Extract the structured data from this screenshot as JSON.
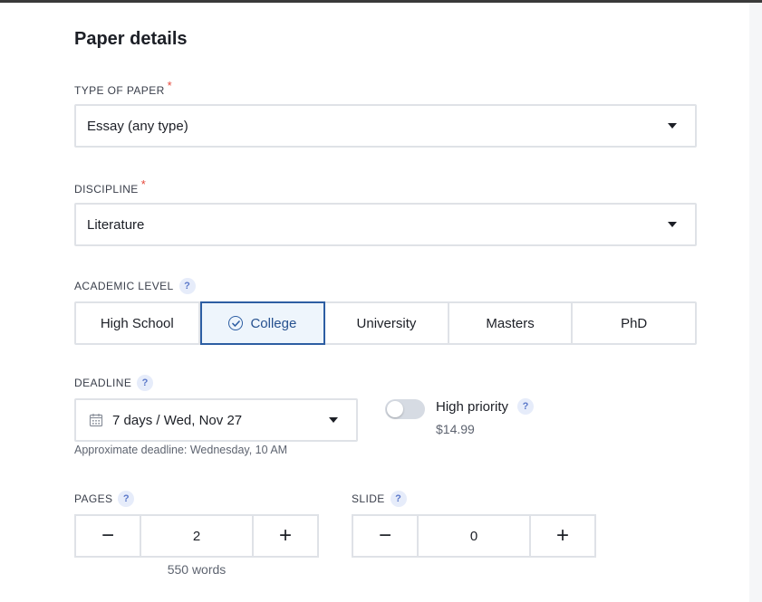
{
  "form": {
    "title": "Paper details",
    "type_of_paper": {
      "label": "TYPE OF PAPER",
      "required_mark": "*",
      "value": "Essay (any type)"
    },
    "discipline": {
      "label": "DISCIPLINE",
      "required_mark": "*",
      "value": "Literature"
    },
    "academic_level": {
      "label": "ACADEMIC LEVEL",
      "help": "?",
      "options": [
        "High School",
        "College",
        "University",
        "Masters",
        "PhD"
      ],
      "selected": "College"
    },
    "deadline": {
      "label": "DEADLINE",
      "help": "?",
      "value": "7 days / Wed, Nov 27",
      "approx": "Approximate deadline: Wednesday, 10 AM"
    },
    "high_priority": {
      "label": "High priority",
      "help": "?",
      "price": "$14.99",
      "enabled": false
    },
    "pages": {
      "label": "PAGES",
      "help": "?",
      "value": "2",
      "words": "550 words",
      "minus": "−",
      "plus": "+"
    },
    "slide": {
      "label": "SLIDE",
      "help": "?",
      "value": "0",
      "minus": "−",
      "plus": "+"
    }
  },
  "colors": {
    "accent": "#2d5ea3",
    "selected_bg": "#eef5fc",
    "required": "#e5483b",
    "border": "#dfe2e7"
  },
  "icons": [
    "check-circle-icon",
    "calendar-icon",
    "caret-down-icon",
    "help-icon"
  ]
}
